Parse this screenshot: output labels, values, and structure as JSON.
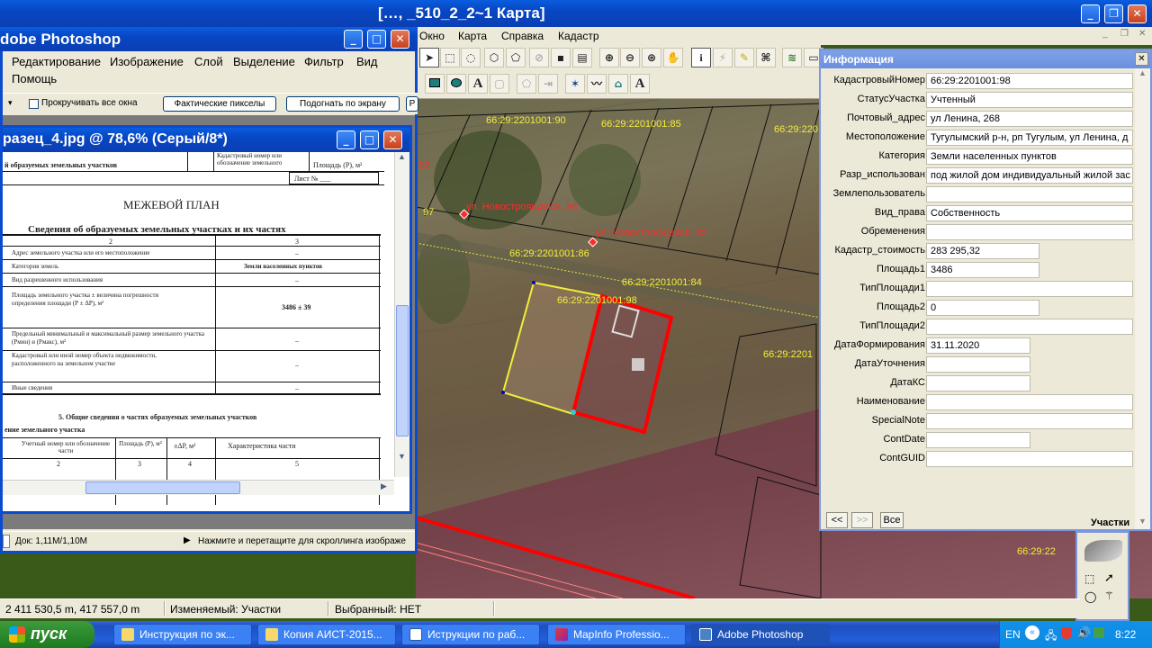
{
  "mapinfo": {
    "title": "[…, _510_2_2~1 Карта]",
    "menu": [
      "Окно",
      "Карта",
      "Справка",
      "Кадастр"
    ]
  },
  "map": {
    "parcel_labels": [
      "66:29:2201001:90",
      "66:29:2201001:85",
      "66:29:220",
      "66:29:2201001:86",
      "66:29:2201001:84",
      "66:29:2201001:98",
      "66:29:2201",
      "66:29:22"
    ],
    "number_labels": [
      "97",
      "82"
    ],
    "address_labels": [
      "ул. Новостроящаяся, 86",
      "ул. Новостроящаяся, 82"
    ]
  },
  "photoshop": {
    "title": "dobe Photoshop",
    "menu": [
      "Редактирование",
      "Изображение",
      "Слой",
      "Выделение",
      "Фильтр",
      "Вид",
      "Помощь"
    ],
    "options": {
      "scroll_all_label": "Прокручивать все окна",
      "actual_pixels": "Фактические пикселы",
      "fit_screen": "Подогнать по экрану",
      "print_size": "Р"
    },
    "document": {
      "title": "разец_4.jpg @ 78,6% (Серый/8*)",
      "heading": "МЕЖЕВОЙ ПЛАН",
      "subheading": "Сведения об образуемых земельных участках и их частях",
      "top_cells": [
        "й образуемых земельных участков",
        "Кадастровый номер или обозначение земельного",
        "Площадь (Р), м²"
      ],
      "sheet": "Лист № ___",
      "col_num_2": "2",
      "col_num_3": "3",
      "rows": [
        {
          "label": "Адрес земельного участка или его местоположение",
          "value": "–"
        },
        {
          "label": "Категория земель",
          "value": "Земли населенных пунктов"
        },
        {
          "label": "Вид разрешенного использования",
          "value": "–"
        },
        {
          "label": "Площадь земельного участка ± величина погрешности определения площади (Р ± ΔР), м²",
          "value": "3486 ± 39"
        },
        {
          "label": "Предельный минимальный и максимальный размер земельного участка (Рмин) и (Рмакс), м²",
          "value": "–"
        },
        {
          "label": "Кадастровый или иной номер объекта недвижимости, расположенного на земельном участке",
          "value": "–"
        },
        {
          "label": "Иные сведения",
          "value": "–"
        }
      ],
      "section5": "5. Общие сведения о частях образуемых земельных участков",
      "section5_sub": "ение земельного участка",
      "bottom_headers": [
        "Учетный номер или обозначение части",
        "Площадь (Р), м²",
        "±ΔР, м²",
        "Характеристика части"
      ],
      "bottom_nums": [
        "2",
        "3",
        "4",
        "5"
      ]
    },
    "status": {
      "doc": "Док: 1,11М/1,10М",
      "hint": "Нажмите и перетащите для скроллинга изображе"
    }
  },
  "info": {
    "title": "Информация",
    "fields": [
      {
        "label": "КадастровыйНомер:",
        "value": "66:29:2201001:98",
        "w": "wide"
      },
      {
        "label": "СтатусУчастка:",
        "value": "Учтенный",
        "w": "wide"
      },
      {
        "label": "Почтовый_адрес:",
        "value": " ул Ленина, 268",
        "w": "wide"
      },
      {
        "label": "Местоположение:",
        "value": "Тугулымский р-н, рп Тугулым, ул Ленина, д",
        "w": "wide"
      },
      {
        "label": "Категория:",
        "value": "Земли населенных пунктов",
        "w": "wide"
      },
      {
        "label": "Разр_использован:",
        "value": "под жилой дом индивидуальный жилой зас",
        "w": "wide"
      },
      {
        "label": "Землепользователь:",
        "value": "",
        "w": "wide"
      },
      {
        "label": "Вид_права:",
        "value": "Собственность",
        "w": "wide"
      },
      {
        "label": "Обременения:",
        "value": "",
        "w": "wide"
      },
      {
        "label": "Кадастр_стоимость:",
        "value": "283 295,32",
        "w": "mid"
      },
      {
        "label": "Площадь1:",
        "value": "3486",
        "w": "mid"
      },
      {
        "label": "ТипПлощади1:",
        "value": "",
        "w": "wide"
      },
      {
        "label": "Площадь2:",
        "value": "0",
        "w": "mid"
      },
      {
        "label": "ТипПлощади2:",
        "value": "",
        "w": "wide"
      },
      {
        "label": "ДатаФормирования:",
        "value": "31.11.2020",
        "w": "short"
      },
      {
        "label": "ДатаУточнения:",
        "value": "",
        "w": "short"
      },
      {
        "label": "ДатаКС:",
        "value": "",
        "w": "short"
      },
      {
        "label": "Наименование:",
        "value": "",
        "w": "wide"
      },
      {
        "label": "SpecialNote:",
        "value": "",
        "w": "wide"
      },
      {
        "label": "ContDate:",
        "value": "",
        "w": "short"
      },
      {
        "label": "ContGUID:",
        "value": "",
        "w": "wide"
      }
    ],
    "nav": {
      "prev": "<<",
      "next": ">>",
      "all": "Все"
    },
    "layer": "Участки"
  },
  "status_bar": {
    "coords": "2 411 530,5 m, 417 557,0 m",
    "editable": "Изменяемый: Участки",
    "selected": "Выбранный: НЕТ"
  },
  "taskbar": {
    "start": "пуск",
    "tasks": [
      "Инструкция по эк...",
      "Копия АИСТ-2015...",
      "Иструкции по раб...",
      "MapInfo Professio...",
      "Adobe Photoshop"
    ],
    "lang": "EN",
    "time": "8:22"
  },
  "colors": {
    "xp_blue": "#0746c2",
    "parcel_red": "#ff0000",
    "parcel_yellow": "#f2ee3a"
  }
}
